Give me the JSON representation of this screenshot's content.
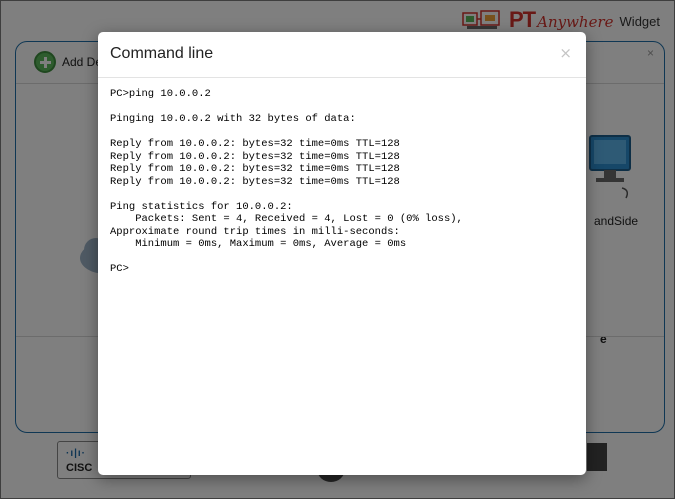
{
  "brand": {
    "pt": "PT",
    "anywhere": "Anywhere",
    "widget": "Widget"
  },
  "panel": {
    "add_device_label": "Add De",
    "close_glyph": "×",
    "device_label_1": "andSide",
    "device_label_2": "e"
  },
  "footer": {
    "cisco_bars": "·ı|ı·",
    "cisco_text": "CISC",
    "small_text": "itute"
  },
  "modal": {
    "title": "Command line",
    "close_glyph": "×",
    "lines": [
      "PC>ping 10.0.0.2",
      "",
      "Pinging 10.0.0.2 with 32 bytes of data:",
      "",
      "Reply from 10.0.0.2: bytes=32 time=0ms TTL=128",
      "Reply from 10.0.0.2: bytes=32 time=0ms TTL=128",
      "Reply from 10.0.0.2: bytes=32 time=0ms TTL=128",
      "Reply from 10.0.0.2: bytes=32 time=0ms TTL=128",
      "",
      "Ping statistics for 10.0.0.2:",
      "    Packets: Sent = 4, Received = 4, Lost = 0 (0% loss),",
      "Approximate round trip times in milli-seconds:",
      "    Minimum = 0ms, Maximum = 0ms, Average = 0ms",
      "",
      "PC>"
    ]
  },
  "icons": {
    "add": "add-circle-icon",
    "close": "close-icon",
    "cloud": "cloud-icon",
    "monitor": "pc-monitor-icon"
  },
  "colors": {
    "accent": "#1f6fa8",
    "brand_red": "#d2322d",
    "add_green": "#5cb85c"
  }
}
